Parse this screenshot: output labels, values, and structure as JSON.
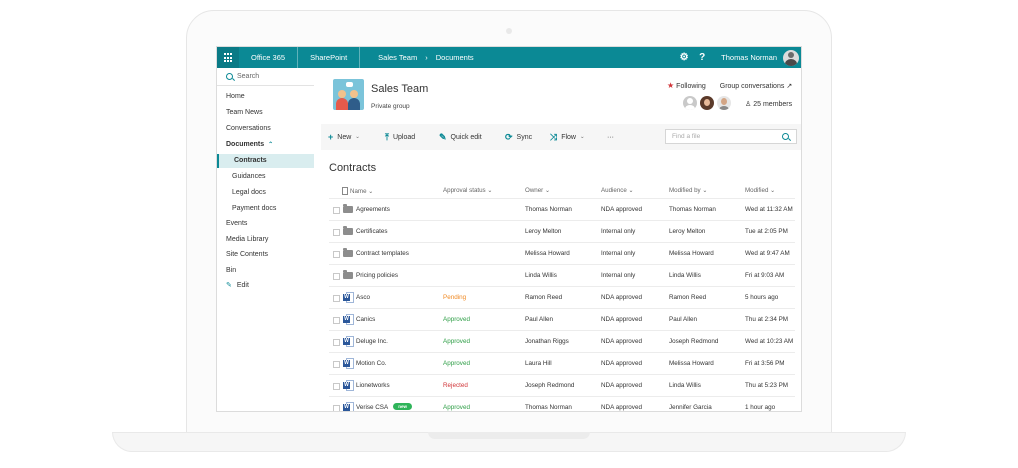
{
  "suite_bar": {
    "app_name": "Office 365",
    "product": "SharePoint",
    "breadcrumb": [
      "Sales Team",
      "Documents"
    ],
    "breadcrumb_separator": "›",
    "help": "?",
    "user_name": "Thomas Norman",
    "accent_color": "#0b8995"
  },
  "nav": {
    "search_label": "Search",
    "items": [
      {
        "label": "Home",
        "level": 0
      },
      {
        "label": "Team News",
        "level": 0
      },
      {
        "label": "Conversations",
        "level": 0
      },
      {
        "label": "Documents",
        "level": 0,
        "expanded": true
      },
      {
        "label": "Contracts",
        "level": 1,
        "selected": true
      },
      {
        "label": "Guidances",
        "level": 1
      },
      {
        "label": "Legal docs",
        "level": 1
      },
      {
        "label": "Payment docs",
        "level": 1
      },
      {
        "label": "Events",
        "level": 0
      },
      {
        "label": "Media Library",
        "level": 0
      },
      {
        "label": "Site Contents",
        "level": 0
      },
      {
        "label": "Bin",
        "level": 0
      }
    ],
    "edit_label": "Edit"
  },
  "site": {
    "title": "Sales Team",
    "subtitle": "Private group",
    "following_label": "Following",
    "group_conversations_label": "Group conversations",
    "members_label": "25 members"
  },
  "commands": {
    "new": "New",
    "upload": "Upload",
    "quick_edit": "Quick edit",
    "sync": "Sync",
    "flow": "Flow",
    "more": "···",
    "find_placeholder": "Find a file"
  },
  "library": {
    "title": "Contracts",
    "columns": {
      "name": "Name",
      "approval": "Approval status",
      "owner": "Owner",
      "audience": "Audience",
      "modified_by": "Modified by",
      "modified": "Modified"
    },
    "new_badge": "new",
    "rows": [
      {
        "type": "folder",
        "name": "Agreements",
        "status": "",
        "owner": "Thomas Norman",
        "audience": "NDA approved",
        "modified_by": "Thomas Norman",
        "modified": "Wed at 11:32 AM"
      },
      {
        "type": "folder",
        "name": "Certificates",
        "status": "",
        "owner": "Leroy Melton",
        "audience": "Internal only",
        "modified_by": "Leroy Melton",
        "modified": "Tue at 2:05 PM"
      },
      {
        "type": "folder",
        "name": "Contract templates",
        "status": "",
        "owner": "Melissa Howard",
        "audience": "Internal only",
        "modified_by": "Melissa Howard",
        "modified": "Wed at 9:47 AM"
      },
      {
        "type": "folder",
        "name": "Pricing policies",
        "status": "",
        "owner": "Linda Willis",
        "audience": "Internal only",
        "modified_by": "Linda Willis",
        "modified": "Fri at 9:03 AM"
      },
      {
        "type": "word",
        "name": "Asco",
        "status": "Pending",
        "owner": "Ramon Reed",
        "audience": "NDA approved",
        "modified_by": "Ramon Reed",
        "modified": "5 hours ago"
      },
      {
        "type": "word",
        "name": "Canics",
        "status": "Approved",
        "owner": "Paul Allen",
        "audience": "NDA approved",
        "modified_by": "Paul Allen",
        "modified": "Thu at 2:34 PM"
      },
      {
        "type": "word",
        "name": "Deluge Inc.",
        "status": "Approved",
        "owner": "Jonathan Riggs",
        "audience": "NDA approved",
        "modified_by": "Joseph Redmond",
        "modified": "Wed at 10:23 AM"
      },
      {
        "type": "word",
        "name": "Motion Co.",
        "status": "Approved",
        "owner": "Laura Hill",
        "audience": "NDA approved",
        "modified_by": "Melissa Howard",
        "modified": "Fri at 3:56 PM"
      },
      {
        "type": "word",
        "name": "Lionetworks",
        "status": "Rejected",
        "owner": "Joseph Redmond",
        "audience": "NDA approved",
        "modified_by": "Linda Willis",
        "modified": "Thu at 5:23 PM"
      },
      {
        "type": "word",
        "name": "Verise CSA",
        "is_new": true,
        "status": "Approved",
        "owner": "Thomas Norman",
        "audience": "NDA approved",
        "modified_by": "Jennifer Garcia",
        "modified": "1 hour ago"
      }
    ]
  }
}
